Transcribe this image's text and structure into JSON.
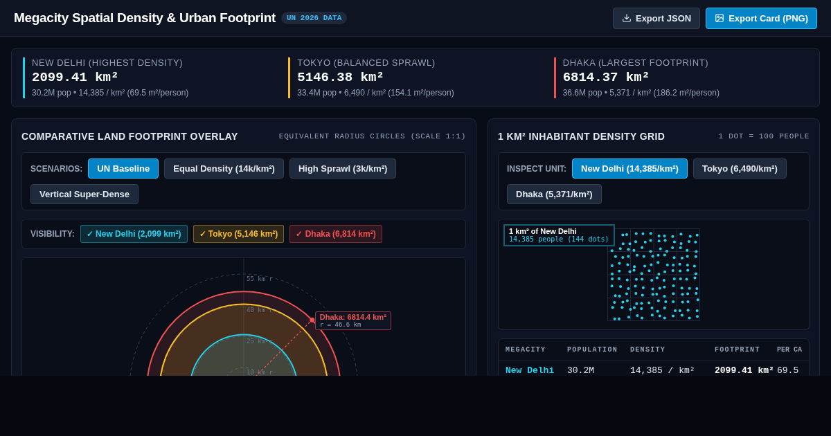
{
  "header": {
    "title": "Megacity Spatial Density & Urban Footprint",
    "badge": "UN 2026 DATA",
    "buttons": [
      {
        "label": "Export JSON",
        "kind": "download",
        "primary": false
      },
      {
        "label": "Export Card (PNG)",
        "kind": "image",
        "primary": true
      }
    ]
  },
  "summary": [
    {
      "label": "NEW DELHI (HIGHEST DENSITY)",
      "value": "2099.41 km²",
      "detail": "30.2M pop • 14,385 / km² (69.5 m²/person)",
      "color": "#22d3ee"
    },
    {
      "label": "TOKYO (BALANCED SPRAWL)",
      "value": "5146.38 km²",
      "detail": "33.4M pop • 6,490 / km² (154.1 m²/person)",
      "color": "#fbbf24"
    },
    {
      "label": "DHAKA (LARGEST FOOTPRINT)",
      "value": "6814.37 km²",
      "detail": "36.6M pop • 5,371 / km² (186.2 m²/person)",
      "color": "#f05252"
    }
  ],
  "overlay": {
    "title": "COMPARATIVE LAND FOOTPRINT OVERLAY",
    "subtitle": "EQUIVALENT RADIUS CIRCLES (SCALE 1:1)",
    "scenarios_label": "SCENARIOS:",
    "scenarios": [
      {
        "label": "UN Baseline",
        "selected": true
      },
      {
        "label": "Equal Density (14k/km²)",
        "selected": false
      },
      {
        "label": "High Sprawl (3k/km²)",
        "selected": false
      },
      {
        "label": "Vertical Super-Dense",
        "selected": false
      }
    ],
    "visibility_label": "VISIBILITY:",
    "visibility": [
      {
        "label": "✓ New Delhi (2,099 km²)",
        "checked": true
      },
      {
        "label": "✓ Tokyo (5,146 km²)",
        "checked": true
      },
      {
        "label": "✓ Dhaka (6,814 km²)",
        "checked": true
      }
    ],
    "rings": [
      "55 km r",
      "40 km r",
      "25 km r",
      "10 km r"
    ],
    "tooltip": {
      "title": "Dhaka: 6814.4 km²",
      "detail": "r = 46.6 km"
    }
  },
  "density": {
    "title": "1 KM² INHABITANT DENSITY GRID",
    "subtitle": "1 DOT = 100 PEOPLE",
    "units_label": "INSPECT UNIT:",
    "units": [
      {
        "label": "New Delhi (14,385/km²)",
        "selected": true
      },
      {
        "label": "Tokyo (6,490/km²)",
        "selected": false
      },
      {
        "label": "Dhaka (5,371/km²)",
        "selected": false
      }
    ],
    "tooltip": {
      "title": "1 km² of New Delhi",
      "detail": "14,385 people (144 dots)"
    },
    "table": {
      "columns": [
        "MEGACITY",
        "POPULATION",
        "DENSITY",
        "FOOTPRINT",
        "PER CA"
      ],
      "rows": [
        [
          "New Delhi",
          "30.2M",
          "14,385 / km²",
          "2099.41 km²",
          "69.5"
        ]
      ]
    }
  }
}
